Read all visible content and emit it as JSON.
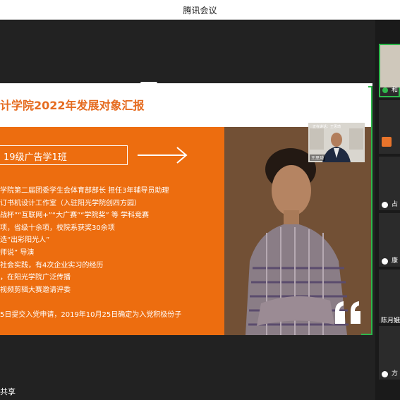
{
  "window": {
    "title": "腾讯会议"
  },
  "slide": {
    "title": "计学院2022年发展对象汇报",
    "class_label": "19级广告学1班",
    "lines": [
      "学院第二届团委学生会体育部部长   担任3年辅导员助理",
      "订书机设计工作室（入驻阳光学院创四方园）",
      "战杯”“互联网+”“大广赛”“学院奖” 等 学科竞赛",
      "项，省级十余项，校院系获奖30余项",
      "选“出彩阳光人”",
      "师说” 导演",
      "社会实践，有4次企业实习的经历",
      "，在阳光学院广泛传播",
      "视频剪辑大赛邀请评委",
      "",
      "5日提交入党申请，2019年10月25日确定为入党积极份子"
    ],
    "highlight_color": "#000000",
    "accent_color": "#ed6d0f",
    "title_color": "#e56b1f"
  },
  "self_view": {
    "name_tag": "王思琦",
    "top_text": "正在讲话：王思琦"
  },
  "participants": [
    {
      "name": "和"
    },
    {
      "name": ""
    },
    {
      "name": "占"
    },
    {
      "name": "康"
    },
    {
      "name": "陈月娥"
    },
    {
      "name": "方"
    }
  ],
  "share_label": "共享",
  "colors": {
    "speaker_border": "#2fb84c",
    "titlebar": "#ffffff",
    "background": "#1f1f1f"
  }
}
